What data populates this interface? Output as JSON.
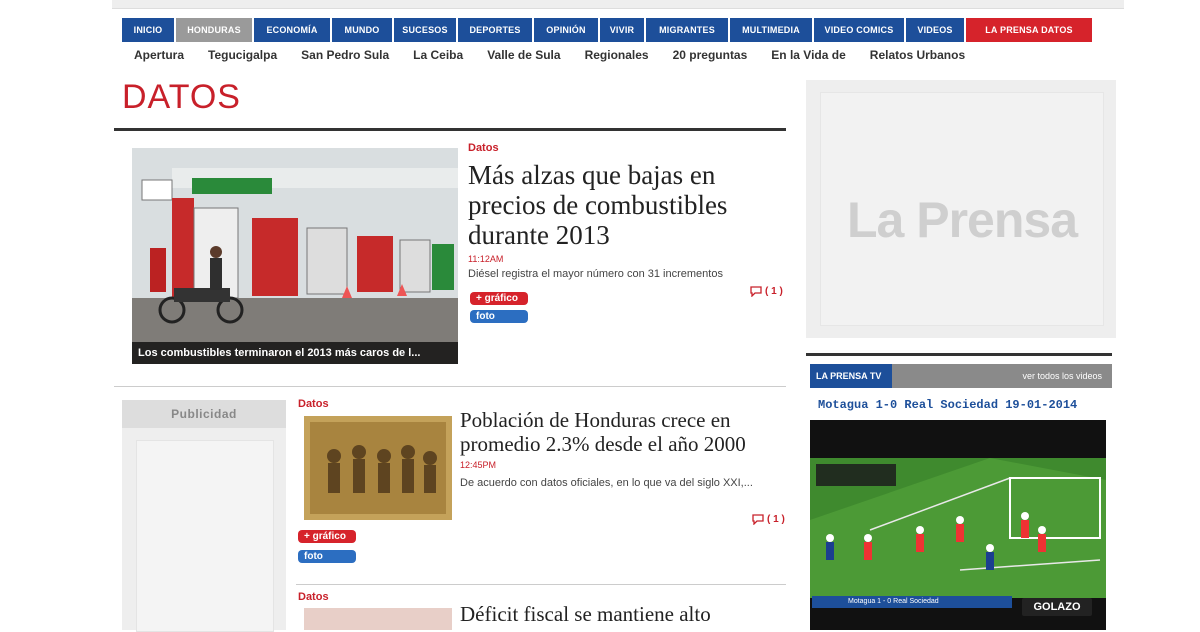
{
  "main_nav": [
    {
      "label": "Inicio"
    },
    {
      "label": "Honduras"
    },
    {
      "label": "Economía"
    },
    {
      "label": "Mundo"
    },
    {
      "label": "Sucesos"
    },
    {
      "label": "Deportes"
    },
    {
      "label": "Opinión"
    },
    {
      "label": "Vivir"
    },
    {
      "label": "Migrantes"
    },
    {
      "label": "Multimedia"
    },
    {
      "label": "Video Comics"
    },
    {
      "label": "Videos"
    },
    {
      "label": "La Prensa Datos"
    }
  ],
  "sub_nav": [
    "Apertura",
    "Tegucigalpa",
    "San Pedro Sula",
    "La Ceiba",
    "Valle de Sula",
    "Regionales",
    "20 preguntas",
    "En la Vida de",
    "Relatos Urbanos"
  ],
  "page_title": "DATOS",
  "articles": [
    {
      "section": "Datos",
      "headline": "Más alzas que bajas en precios de combustibles durante 2013",
      "time": "11:12AM",
      "summary": "Diésel registra el mayor número con 31 incrementos",
      "image_caption": "Los combustibles terminaron el 2013 más caros de l...",
      "tags": [
        "+ gráfico",
        "foto"
      ],
      "comments": "( 1 )"
    },
    {
      "section": "Datos",
      "headline": "Población de Honduras crece en promedio 2.3% desde el año 2000",
      "time": "12:45PM",
      "summary": "De acuerdo con datos oficiales, en lo que va del siglo XXI,...",
      "tags": [
        "+ gráfico",
        "foto"
      ],
      "comments": "( 1 )"
    },
    {
      "section": "Datos",
      "headline": "Déficit fiscal se mantiene alto"
    }
  ],
  "ad_label": "Publicidad",
  "right_ad_logo": "La Prensa",
  "tv": {
    "label": "LA PRENSA TV",
    "link": "ver todos los videos",
    "video_title": "Motagua 1-0 Real Sociedad 19-01-2014",
    "score_overlay": "Motagua 1 - 0 Real Sociedad",
    "brand": "GOLAZO"
  },
  "colors": {
    "nav_blue": "#1d4f9a",
    "brand_red": "#c8202a",
    "nav_active": "#9a9a9a"
  }
}
